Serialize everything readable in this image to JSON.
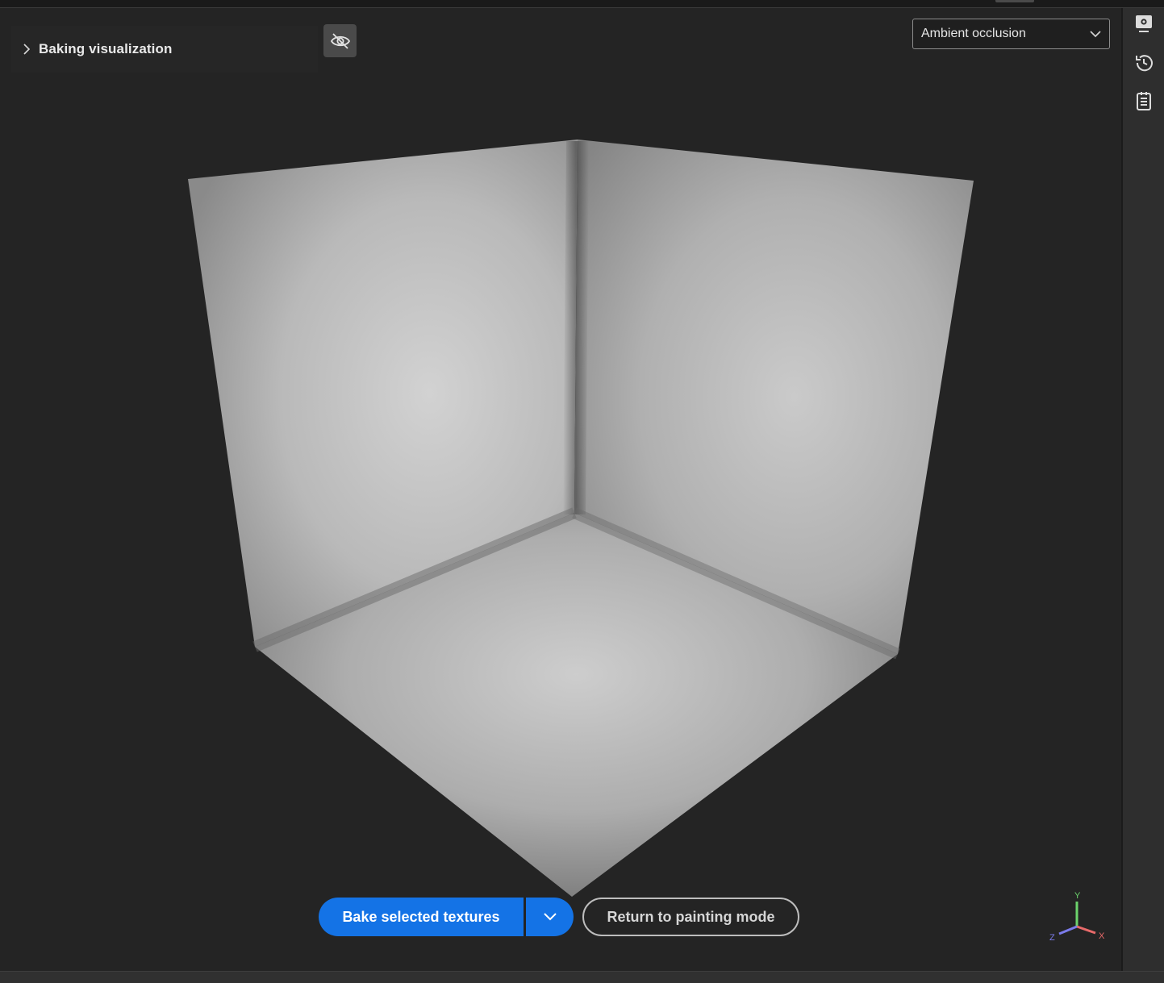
{
  "panel": {
    "title": "Baking visualization",
    "icons": {
      "expand": "chevron-right-icon",
      "visibility": "eye-off-icon"
    }
  },
  "map_selector": {
    "selected": "Ambient occlusion",
    "icon": "chevron-down-icon"
  },
  "actions": {
    "bake_label": "Bake selected textures",
    "bake_options_icon": "chevron-down-icon",
    "return_label": "Return to painting mode",
    "bake_color": "#1473e6"
  },
  "gizmo": {
    "y_label": "Y",
    "x_label": "X",
    "z_label": "Z",
    "colors": {
      "x": "#e86a6a",
      "y": "#6cd36c",
      "z": "#7b7bea"
    }
  },
  "right_bar": {
    "items": [
      {
        "name": "settings-panel-icon"
      },
      {
        "name": "history-icon"
      },
      {
        "name": "log-icon"
      }
    ]
  }
}
